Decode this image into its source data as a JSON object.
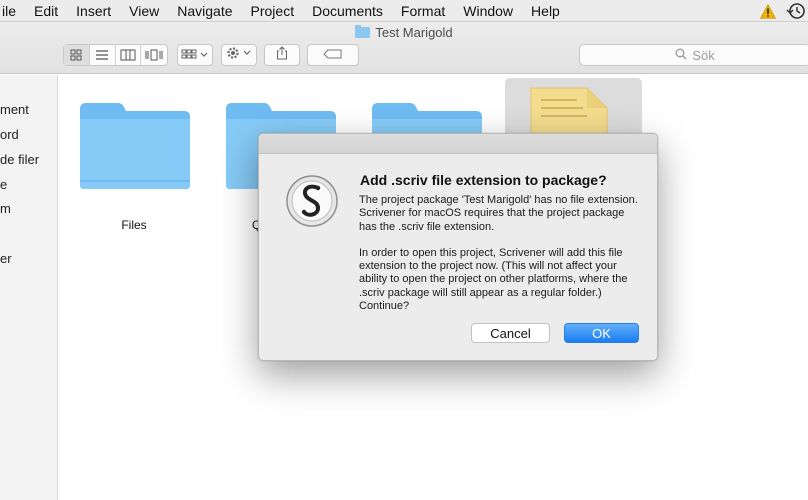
{
  "menubar": {
    "items": [
      "ile",
      "Edit",
      "Insert",
      "View",
      "Navigate",
      "Project",
      "Documents",
      "Format",
      "Window",
      "Help"
    ]
  },
  "icons": {
    "warning": "warning-triangle-icon",
    "time_machine": "time-machine-icon",
    "search": "magnifier-icon",
    "action": "gear-icon",
    "share": "share-icon",
    "tag": "tag-icon",
    "app": "scrivener-icon"
  },
  "window": {
    "title": "Test Marigold",
    "search_placeholder": "Sök"
  },
  "sidebar": {
    "items": [
      "ment",
      "ord",
      "de filer",
      "e",
      "m",
      "er"
    ]
  },
  "content": {
    "items": [
      {
        "label": "Files"
      },
      {
        "label": "Q"
      }
    ]
  },
  "dialog": {
    "title": "Add .scriv file extension to package?",
    "paragraph1": "The project package 'Test Marigold' has no file extension. Scrivener for macOS requires that the project package has the .scriv file extension.",
    "paragraph2": "In order to open this project, Scrivener will add this file extension to the project now. (This will not affect your ability to open the project on other platforms, where the .scriv package will still appear as a regular folder.) Continue?",
    "cancel_label": "Cancel",
    "ok_label": "OK"
  },
  "colors": {
    "accent": "#1a7ef2",
    "folder": "#7cc4f5",
    "warning": "#f1b400"
  }
}
